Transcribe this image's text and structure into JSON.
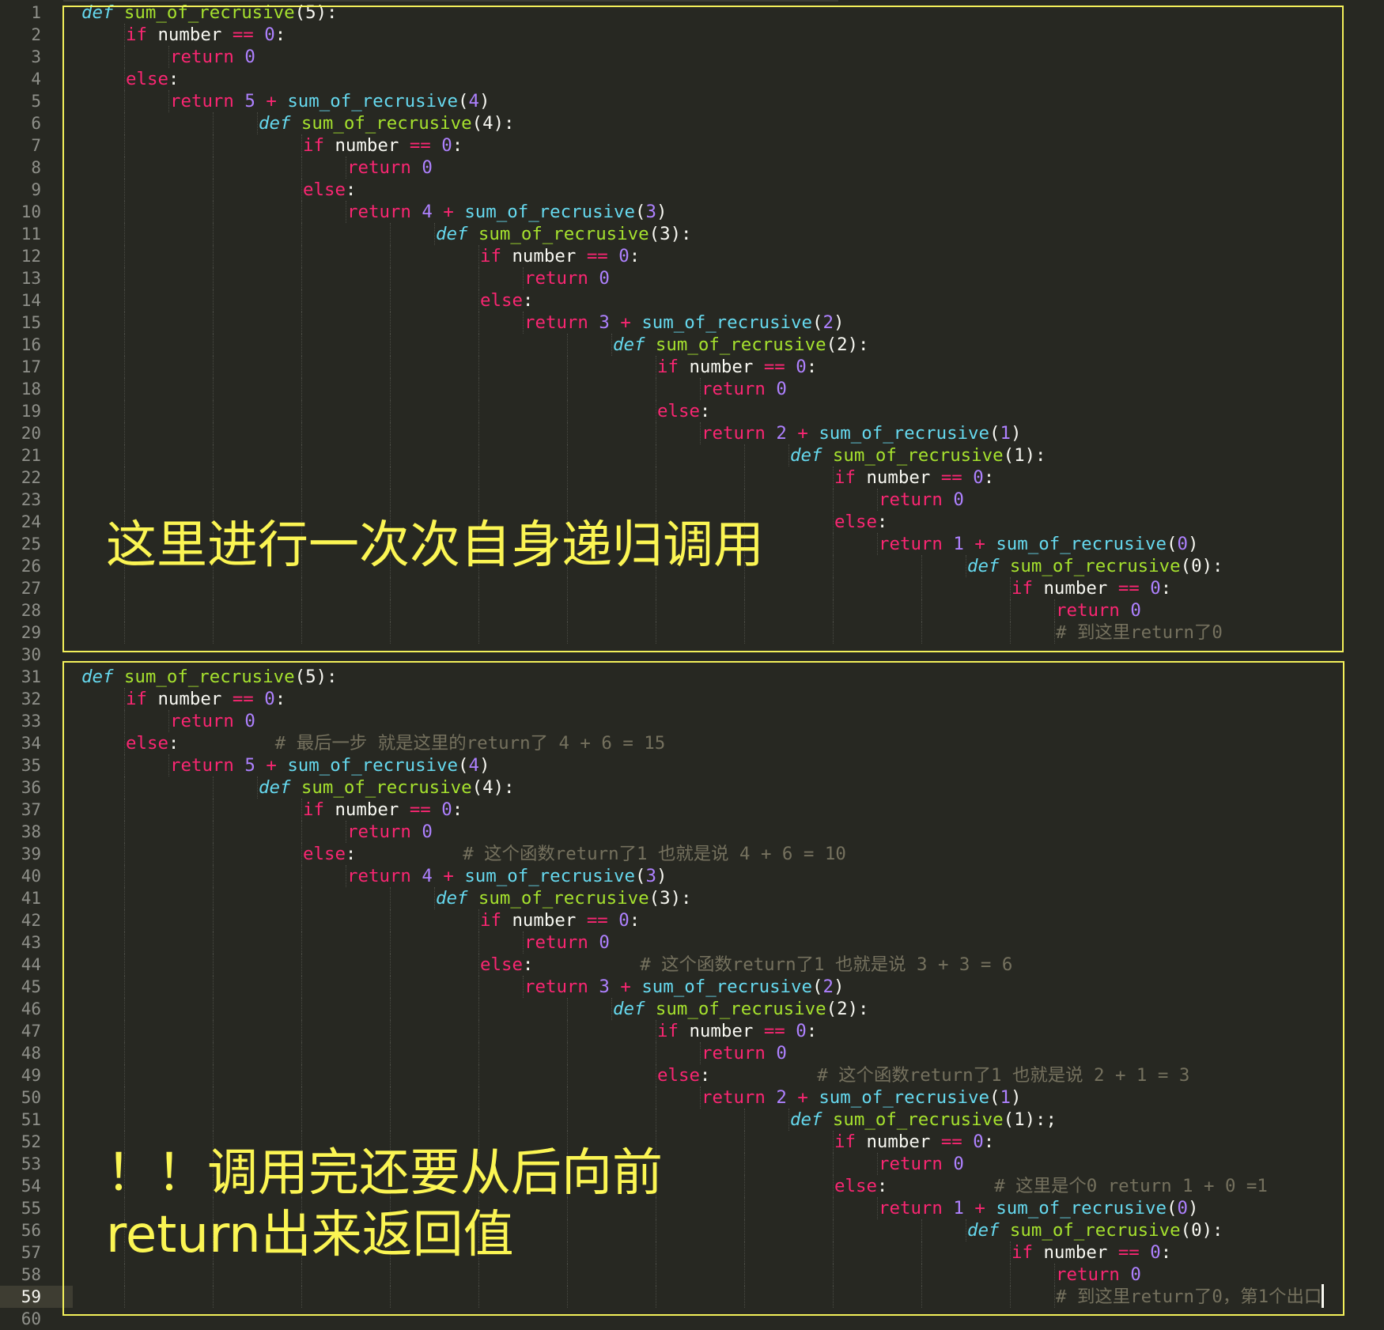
{
  "theme": {
    "background": "#272822",
    "gutter_text": "#8f908a",
    "annotation_color": "#fbf553",
    "box_color": "#f3f05a"
  },
  "editor": {
    "line_numbers": [
      "1",
      "2",
      "3",
      "4",
      "5",
      "6",
      "7",
      "8",
      "9",
      "10",
      "11",
      "12",
      "13",
      "14",
      "15",
      "16",
      "17",
      "18",
      "19",
      "20",
      "21",
      "22",
      "23",
      "24",
      "25",
      "26",
      "27",
      "28",
      "29",
      "30",
      "31",
      "32",
      "33",
      "34",
      "35",
      "36",
      "37",
      "38",
      "39",
      "40",
      "41",
      "42",
      "43",
      "44",
      "45",
      "46",
      "47",
      "48",
      "49",
      "50",
      "51",
      "52",
      "53",
      "54",
      "55",
      "56",
      "57",
      "58",
      "59",
      "60"
    ],
    "active_line": "59",
    "lines": [
      [
        [
          "def ",
          "def"
        ],
        [
          "sum_of_recrusive",
          "fn"
        ],
        [
          "(",
          "id"
        ],
        [
          "5",
          "id"
        ],
        [
          "):",
          "id"
        ]
      ],
      [
        [
          "if ",
          "kw"
        ],
        [
          "number ",
          "id"
        ],
        [
          "== ",
          "op"
        ],
        [
          "0",
          "num"
        ],
        [
          ":",
          "id"
        ]
      ],
      [
        [
          "return ",
          "kw"
        ],
        [
          "0",
          "num"
        ]
      ],
      [
        [
          "else",
          "kw"
        ],
        [
          ":",
          "id"
        ]
      ],
      [
        [
          "return ",
          "kw"
        ],
        [
          "5 ",
          "num"
        ],
        [
          "+ ",
          "op"
        ],
        [
          "sum_of_recrusive",
          "bi"
        ],
        [
          "(",
          "id"
        ],
        [
          "4",
          "num"
        ],
        [
          ")",
          "id"
        ]
      ],
      [
        [
          "def ",
          "def"
        ],
        [
          "sum_of_recrusive",
          "fn"
        ],
        [
          "(4):",
          "id"
        ]
      ],
      [
        [
          "if ",
          "kw"
        ],
        [
          "number ",
          "id"
        ],
        [
          "== ",
          "op"
        ],
        [
          "0",
          "num"
        ],
        [
          ":",
          "id"
        ]
      ],
      [
        [
          "return ",
          "kw"
        ],
        [
          "0",
          "num"
        ]
      ],
      [
        [
          "else",
          "kw"
        ],
        [
          ":",
          "id"
        ]
      ],
      [
        [
          "return ",
          "kw"
        ],
        [
          "4 ",
          "num"
        ],
        [
          "+ ",
          "op"
        ],
        [
          "sum_of_recrusive",
          "bi"
        ],
        [
          "(",
          "id"
        ],
        [
          "3",
          "num"
        ],
        [
          ")",
          "id"
        ]
      ],
      [
        [
          "def ",
          "def"
        ],
        [
          "sum_of_recrusive",
          "fn"
        ],
        [
          "(3):",
          "id"
        ]
      ],
      [
        [
          "if ",
          "kw"
        ],
        [
          "number ",
          "id"
        ],
        [
          "== ",
          "op"
        ],
        [
          "0",
          "num"
        ],
        [
          ":",
          "id"
        ]
      ],
      [
        [
          "return ",
          "kw"
        ],
        [
          "0",
          "num"
        ]
      ],
      [
        [
          "else",
          "kw"
        ],
        [
          ":",
          "id"
        ]
      ],
      [
        [
          "return ",
          "kw"
        ],
        [
          "3 ",
          "num"
        ],
        [
          "+ ",
          "op"
        ],
        [
          "sum_of_recrusive",
          "bi"
        ],
        [
          "(",
          "id"
        ],
        [
          "2",
          "num"
        ],
        [
          ")",
          "id"
        ]
      ],
      [
        [
          "def ",
          "def"
        ],
        [
          "sum_of_recrusive",
          "fn"
        ],
        [
          "(2):",
          "id"
        ]
      ],
      [
        [
          "if ",
          "kw"
        ],
        [
          "number ",
          "id"
        ],
        [
          "== ",
          "op"
        ],
        [
          "0",
          "num"
        ],
        [
          ":",
          "id"
        ]
      ],
      [
        [
          "return ",
          "kw"
        ],
        [
          "0",
          "num"
        ]
      ],
      [
        [
          "else",
          "kw"
        ],
        [
          ":",
          "id"
        ]
      ],
      [
        [
          "return ",
          "kw"
        ],
        [
          "2 ",
          "num"
        ],
        [
          "+ ",
          "op"
        ],
        [
          "sum_of_recrusive",
          "bi"
        ],
        [
          "(",
          "id"
        ],
        [
          "1",
          "num"
        ],
        [
          ")",
          "id"
        ]
      ],
      [
        [
          "def ",
          "def"
        ],
        [
          "sum_of_recrusive",
          "fn"
        ],
        [
          "(1):",
          "id"
        ]
      ],
      [
        [
          "if ",
          "kw"
        ],
        [
          "number ",
          "id"
        ],
        [
          "== ",
          "op"
        ],
        [
          "0",
          "num"
        ],
        [
          ":",
          "id"
        ]
      ],
      [
        [
          "return ",
          "kw"
        ],
        [
          "0",
          "num"
        ]
      ],
      [
        [
          "else",
          "kw"
        ],
        [
          ":",
          "id"
        ]
      ],
      [
        [
          "return ",
          "kw"
        ],
        [
          "1 ",
          "num"
        ],
        [
          "+ ",
          "op"
        ],
        [
          "sum_of_recrusive",
          "bi"
        ],
        [
          "(",
          "id"
        ],
        [
          "0",
          "num"
        ],
        [
          ")",
          "id"
        ]
      ],
      [
        [
          "def ",
          "def"
        ],
        [
          "sum_of_recrusive",
          "fn"
        ],
        [
          "(0):",
          "id"
        ]
      ],
      [
        [
          "if ",
          "kw"
        ],
        [
          "number ",
          "id"
        ],
        [
          "== ",
          "op"
        ],
        [
          "0",
          "num"
        ],
        [
          ":",
          "id"
        ]
      ],
      [
        [
          "return ",
          "kw"
        ],
        [
          "0",
          "num"
        ]
      ],
      [
        [
          "# 到这里return了0",
          "cm"
        ]
      ],
      [],
      [
        [
          "def ",
          "def"
        ],
        [
          "sum_of_recrusive",
          "fn"
        ],
        [
          "(5):",
          "id"
        ]
      ],
      [
        [
          "if ",
          "kw"
        ],
        [
          "number ",
          "id"
        ],
        [
          "== ",
          "op"
        ],
        [
          "0",
          "num"
        ],
        [
          ":",
          "id"
        ]
      ],
      [
        [
          "return ",
          "kw"
        ],
        [
          "0",
          "num"
        ]
      ],
      [
        [
          "else",
          "kw"
        ],
        [
          ":",
          "id"
        ],
        [
          "         # 最后一步 就是这里的return了 4 + 6 = 15",
          "cm"
        ]
      ],
      [
        [
          "return ",
          "kw"
        ],
        [
          "5 ",
          "num"
        ],
        [
          "+ ",
          "op"
        ],
        [
          "sum_of_recrusive",
          "bi"
        ],
        [
          "(",
          "id"
        ],
        [
          "4",
          "num"
        ],
        [
          ")",
          "id"
        ]
      ],
      [
        [
          "def ",
          "def"
        ],
        [
          "sum_of_recrusive",
          "fn"
        ],
        [
          "(4):",
          "id"
        ]
      ],
      [
        [
          "if ",
          "kw"
        ],
        [
          "number ",
          "id"
        ],
        [
          "== ",
          "op"
        ],
        [
          "0",
          "num"
        ],
        [
          ":",
          "id"
        ]
      ],
      [
        [
          "return ",
          "kw"
        ],
        [
          "0",
          "num"
        ]
      ],
      [
        [
          "else",
          "kw"
        ],
        [
          ":",
          "id"
        ],
        [
          "          # 这个函数return了1 也就是说 4 + 6 = 10",
          "cm"
        ]
      ],
      [
        [
          "return ",
          "kw"
        ],
        [
          "4 ",
          "num"
        ],
        [
          "+ ",
          "op"
        ],
        [
          "sum_of_recrusive",
          "bi"
        ],
        [
          "(",
          "id"
        ],
        [
          "3",
          "num"
        ],
        [
          ")",
          "id"
        ]
      ],
      [
        [
          "def ",
          "def"
        ],
        [
          "sum_of_recrusive",
          "fn"
        ],
        [
          "(3):",
          "id"
        ]
      ],
      [
        [
          "if ",
          "kw"
        ],
        [
          "number ",
          "id"
        ],
        [
          "== ",
          "op"
        ],
        [
          "0",
          "num"
        ],
        [
          ":",
          "id"
        ]
      ],
      [
        [
          "return ",
          "kw"
        ],
        [
          "0",
          "num"
        ]
      ],
      [
        [
          "else",
          "kw"
        ],
        [
          ":",
          "id"
        ],
        [
          "          # 这个函数return了1 也就是说 3 + 3 = 6",
          "cm"
        ]
      ],
      [
        [
          "return ",
          "kw"
        ],
        [
          "3 ",
          "num"
        ],
        [
          "+ ",
          "op"
        ],
        [
          "sum_of_recrusive",
          "bi"
        ],
        [
          "(",
          "id"
        ],
        [
          "2",
          "num"
        ],
        [
          ")",
          "id"
        ]
      ],
      [
        [
          "def ",
          "def"
        ],
        [
          "sum_of_recrusive",
          "fn"
        ],
        [
          "(2):",
          "id"
        ]
      ],
      [
        [
          "if ",
          "kw"
        ],
        [
          "number ",
          "id"
        ],
        [
          "== ",
          "op"
        ],
        [
          "0",
          "num"
        ],
        [
          ":",
          "id"
        ]
      ],
      [
        [
          "return ",
          "kw"
        ],
        [
          "0",
          "num"
        ]
      ],
      [
        [
          "else",
          "kw"
        ],
        [
          ":",
          "id"
        ],
        [
          "          # 这个函数return了1 也就是说 2 + 1 = 3",
          "cm"
        ]
      ],
      [
        [
          "return ",
          "kw"
        ],
        [
          "2 ",
          "num"
        ],
        [
          "+ ",
          "op"
        ],
        [
          "sum_of_recrusive",
          "bi"
        ],
        [
          "(",
          "id"
        ],
        [
          "1",
          "num"
        ],
        [
          ")",
          "id"
        ]
      ],
      [
        [
          "def ",
          "def"
        ],
        [
          "sum_of_recrusive",
          "fn"
        ],
        [
          "(1):;",
          "id"
        ]
      ],
      [
        [
          "if ",
          "kw"
        ],
        [
          "number ",
          "id"
        ],
        [
          "== ",
          "op"
        ],
        [
          "0",
          "num"
        ],
        [
          ":",
          "id"
        ]
      ],
      [
        [
          "return ",
          "kw"
        ],
        [
          "0",
          "num"
        ]
      ],
      [
        [
          "else",
          "kw"
        ],
        [
          ":",
          "id"
        ],
        [
          "          # 这里是个0 return 1 + 0 =1",
          "cm"
        ]
      ],
      [
        [
          "return ",
          "kw"
        ],
        [
          "1 ",
          "num"
        ],
        [
          "+ ",
          "op"
        ],
        [
          "sum_of_recrusive",
          "bi"
        ],
        [
          "(",
          "id"
        ],
        [
          "0",
          "num"
        ],
        [
          ")",
          "id"
        ]
      ],
      [
        [
          "def ",
          "def"
        ],
        [
          "sum_of_recrusive",
          "fn"
        ],
        [
          "(0):",
          "id"
        ]
      ],
      [
        [
          "if ",
          "kw"
        ],
        [
          "number ",
          "id"
        ],
        [
          "== ",
          "op"
        ],
        [
          "0",
          "num"
        ],
        [
          ":",
          "id"
        ]
      ],
      [
        [
          "return ",
          "kw"
        ],
        [
          "0",
          "num"
        ]
      ],
      [
        [
          "# 到这里return了0，第1个出口",
          "cm"
        ]
      ],
      []
    ]
  },
  "annotations": {
    "top": "这里进行一次次自身递归调用",
    "bottom_line1": "！！调用完还要从后向前",
    "bottom_line2": "return出来返回值"
  }
}
